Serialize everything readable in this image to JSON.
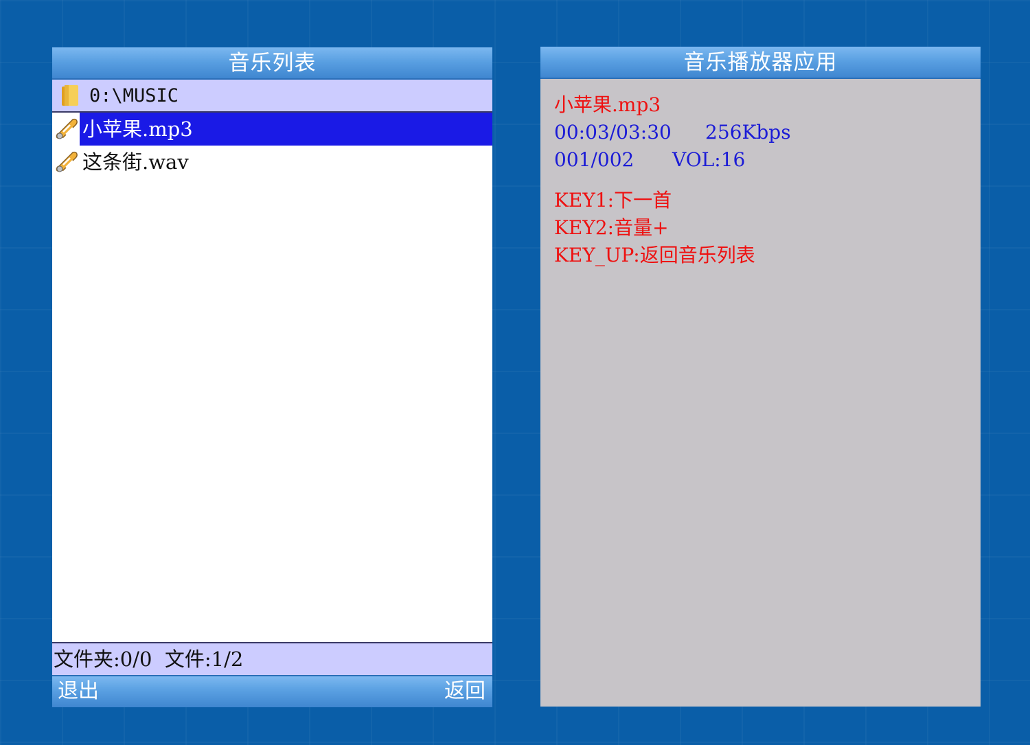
{
  "colors": {
    "background": "#0a5ea8",
    "titlebar": "#5aa0e2",
    "selection": "#1a1ae6",
    "row_highlight": "#ccccff",
    "player_bg": "#c7c4c8",
    "red_text": "#ee1111",
    "blue_text": "#1b1bd6"
  },
  "music_list": {
    "title": "音乐列表",
    "path_icon": "folder-icon",
    "path": "0:\\MUSIC",
    "files": [
      {
        "name": "小苹果.mp3",
        "icon": "music-note-icon",
        "selected": true
      },
      {
        "name": "这条街.wav",
        "icon": "music-note-icon",
        "selected": false
      }
    ],
    "status": "文件夹:0/0  文件:1/2",
    "exit_label": "退出",
    "back_label": "返回"
  },
  "player": {
    "title": "音乐播放器应用",
    "track_name": "小苹果.mp3",
    "time": "00:03/03:30",
    "bitrate": "256Kbps",
    "track_index": "001/002",
    "volume": "VOL:16",
    "key1": "KEY1:下一首",
    "key2": "KEY2:音量+",
    "key_up": "KEY_UP:返回音乐列表"
  }
}
